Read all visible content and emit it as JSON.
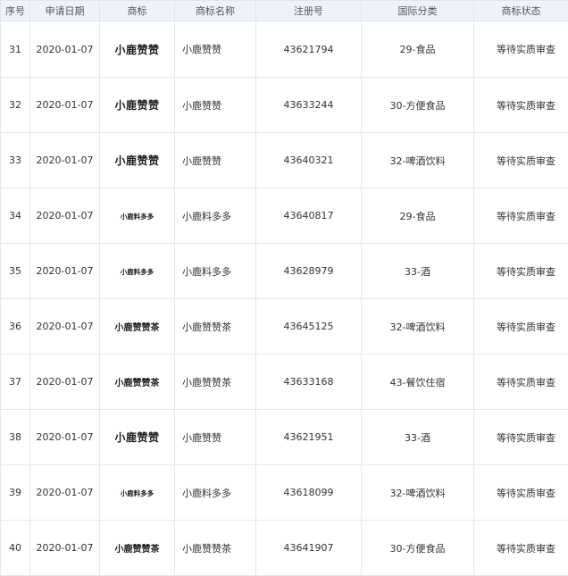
{
  "table": {
    "headers": [
      "序号",
      "申请日期",
      "商标",
      "商标名称",
      "注册号",
      "国际分类",
      "商标状态"
    ],
    "rows": [
      {
        "no": "31",
        "date": "2020-01-07",
        "mark_text": "小鹿赞赞",
        "mark_style": "lg",
        "name": "小鹿赞赞",
        "reg_no": "43621794",
        "class": "29-食品",
        "status": "等待实质审查"
      },
      {
        "no": "32",
        "date": "2020-01-07",
        "mark_text": "小鹿赞赞",
        "mark_style": "lg",
        "name": "小鹿赞赞",
        "reg_no": "43633244",
        "class": "30-方便食品",
        "status": "等待实质审查"
      },
      {
        "no": "33",
        "date": "2020-01-07",
        "mark_text": "小鹿赞赞",
        "mark_style": "lg",
        "name": "小鹿赞赞",
        "reg_no": "43640321",
        "class": "32-啤酒饮料",
        "status": "等待实质审查"
      },
      {
        "no": "34",
        "date": "2020-01-07",
        "mark_text": "小鹿料多多",
        "mark_style": "sm",
        "name": "小鹿料多多",
        "reg_no": "43640817",
        "class": "29-食品",
        "status": "等待实质审查"
      },
      {
        "no": "35",
        "date": "2020-01-07",
        "mark_text": "小鹿料多多",
        "mark_style": "sm",
        "name": "小鹿料多多",
        "reg_no": "43628979",
        "class": "33-酒",
        "status": "等待实质审查"
      },
      {
        "no": "36",
        "date": "2020-01-07",
        "mark_text": "小鹿赞赞茶",
        "mark_style": "md",
        "name": "小鹿赞赞茶",
        "reg_no": "43645125",
        "class": "32-啤酒饮料",
        "status": "等待实质审查"
      },
      {
        "no": "37",
        "date": "2020-01-07",
        "mark_text": "小鹿赞赞茶",
        "mark_style": "md",
        "name": "小鹿赞赞茶",
        "reg_no": "43633168",
        "class": "43-餐饮住宿",
        "status": "等待实质审查"
      },
      {
        "no": "38",
        "date": "2020-01-07",
        "mark_text": "小鹿赞赞",
        "mark_style": "lg",
        "name": "小鹿赞赞",
        "reg_no": "43621951",
        "class": "33-酒",
        "status": "等待实质审查"
      },
      {
        "no": "39",
        "date": "2020-01-07",
        "mark_text": "小鹿料多多",
        "mark_style": "sm",
        "name": "小鹿料多多",
        "reg_no": "43618099",
        "class": "32-啤酒饮料",
        "status": "等待实质审查"
      },
      {
        "no": "40",
        "date": "2020-01-07",
        "mark_text": "小鹿赞赞茶",
        "mark_style": "md",
        "name": "小鹿赞赞茶",
        "reg_no": "43641907",
        "class": "30-方便食品",
        "status": "等待实质审查"
      }
    ]
  },
  "colors": {
    "header_bg": "#eef3fb",
    "border": "#e4e8ee",
    "text": "#333333"
  }
}
